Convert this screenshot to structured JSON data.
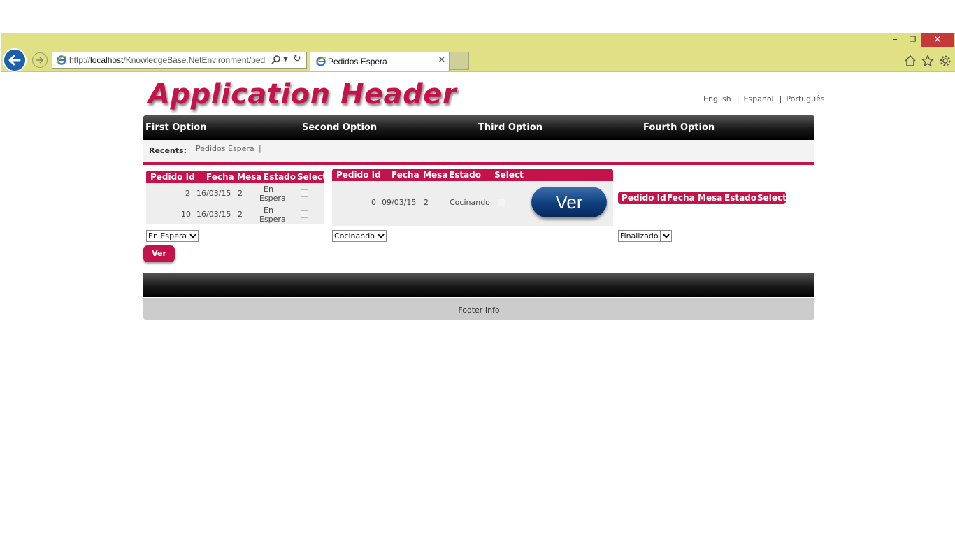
{
  "browser": {
    "url_prefix": "http://",
    "url_host": "localhost",
    "url_path": "/KnowledgeBase.NetEnvironment/ped",
    "tab_title": "Pedidos Espera",
    "window_buttons": {
      "minimize": "–",
      "restore": "❐",
      "close": "✕"
    }
  },
  "header": {
    "title": "Application Header",
    "languages": [
      "English",
      "Español",
      "Português"
    ],
    "lang_separator": "|"
  },
  "menu": {
    "items": [
      "First Option",
      "Second Option",
      "Third Option",
      "Fourth Option"
    ]
  },
  "recents": {
    "label": "Recents:",
    "items": [
      "Pedidos Espera"
    ],
    "separator": "|"
  },
  "grids": {
    "columns": [
      "Pedido Id",
      "Fecha",
      "Mesa",
      "Estado",
      "Select"
    ],
    "espera": {
      "rows": [
        {
          "pedido_id": "2",
          "fecha": "16/03/15",
          "mesa": "2",
          "estado_1": "En",
          "estado_2": "Espera",
          "selected": false
        },
        {
          "pedido_id": "10",
          "fecha": "16/03/15",
          "mesa": "2",
          "estado_1": "En",
          "estado_2": "Espera",
          "selected": false
        }
      ],
      "filter_value": "En Espera"
    },
    "cocinando": {
      "rows": [
        {
          "pedido_id": "0",
          "fecha": "09/03/15",
          "mesa": "2",
          "estado": "Cocinando",
          "selected": false
        }
      ],
      "filter_value": "Cocinando",
      "button_label": "Ver"
    },
    "finalizado": {
      "rows": [],
      "filter_value": "Finalizado"
    }
  },
  "actions": {
    "ver_label": "Ver"
  },
  "footer": {
    "info": "Footer Info"
  },
  "colors": {
    "accent": "#c4134b",
    "chrome": "#e0e085",
    "ver_button": "#0e3e7c"
  }
}
